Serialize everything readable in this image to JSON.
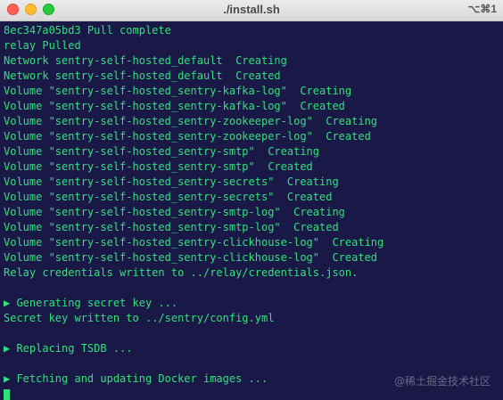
{
  "window": {
    "title": "./install.sh",
    "shortcut": "⌥⌘1"
  },
  "colors": {
    "background": "#1a1846",
    "text": "#2fe07f"
  },
  "terminal": {
    "lines": [
      "8ec347a05bd3 Pull complete",
      "relay Pulled",
      "Network sentry-self-hosted_default  Creating",
      "Network sentry-self-hosted_default  Created",
      "Volume \"sentry-self-hosted_sentry-kafka-log\"  Creating",
      "Volume \"sentry-self-hosted_sentry-kafka-log\"  Created",
      "Volume \"sentry-self-hosted_sentry-zookeeper-log\"  Creating",
      "Volume \"sentry-self-hosted_sentry-zookeeper-log\"  Created",
      "Volume \"sentry-self-hosted_sentry-smtp\"  Creating",
      "Volume \"sentry-self-hosted_sentry-smtp\"  Created",
      "Volume \"sentry-self-hosted_sentry-secrets\"  Creating",
      "Volume \"sentry-self-hosted_sentry-secrets\"  Created",
      "Volume \"sentry-self-hosted_sentry-smtp-log\"  Creating",
      "Volume \"sentry-self-hosted_sentry-smtp-log\"  Created",
      "Volume \"sentry-self-hosted_sentry-clickhouse-log\"  Creating",
      "Volume \"sentry-self-hosted_sentry-clickhouse-log\"  Created",
      "Relay credentials written to ../relay/credentials.json.",
      "",
      "▶ Generating secret key ...",
      "Secret key written to ../sentry/config.yml",
      "",
      "▶ Replacing TSDB ...",
      "",
      "▶ Fetching and updating Docker images ..."
    ]
  },
  "watermark": "@稀土掘金技术社区"
}
